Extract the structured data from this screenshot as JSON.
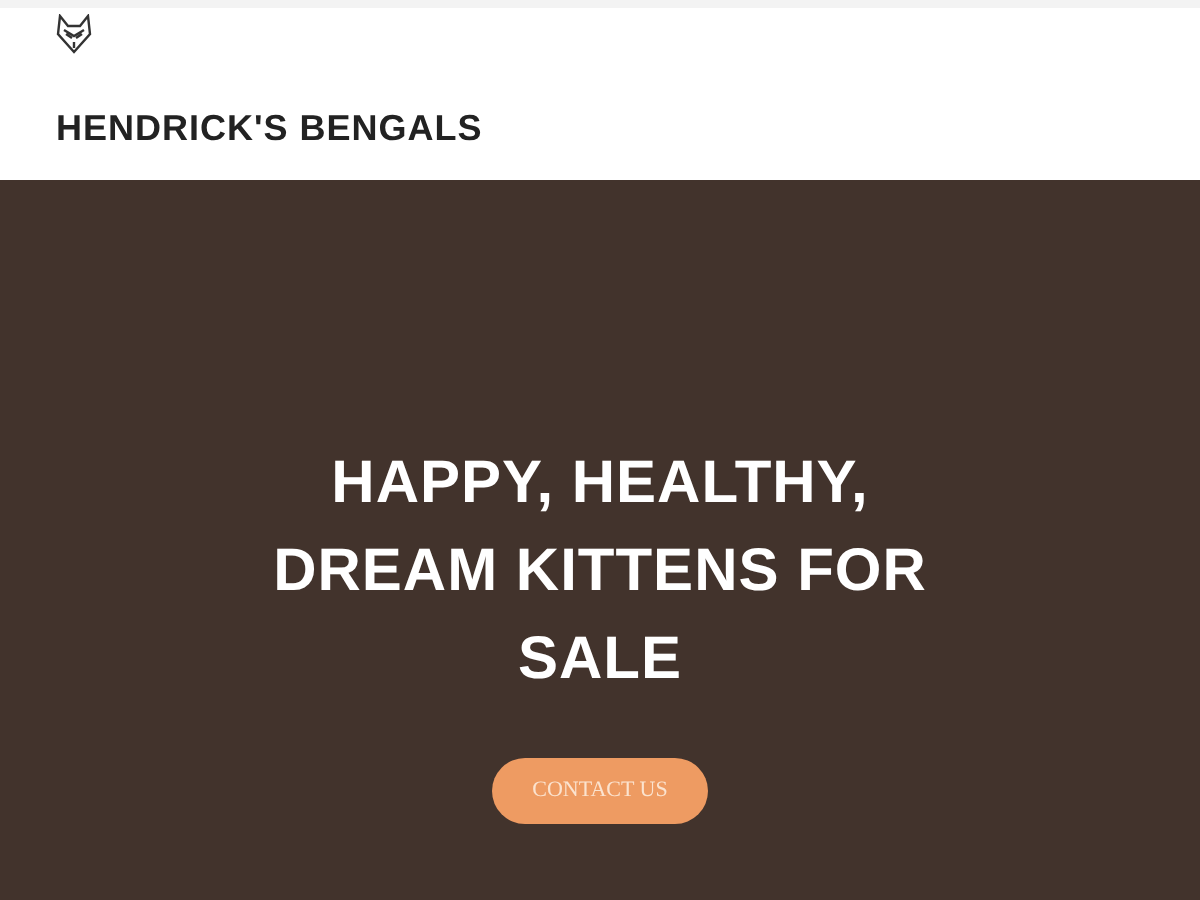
{
  "header": {
    "brand": "HENDRICK'S BENGALS"
  },
  "hero": {
    "headline": "HAPPY, HEALTHY, DREAM KITTENS FOR SALE",
    "button": "CONTACT US"
  }
}
